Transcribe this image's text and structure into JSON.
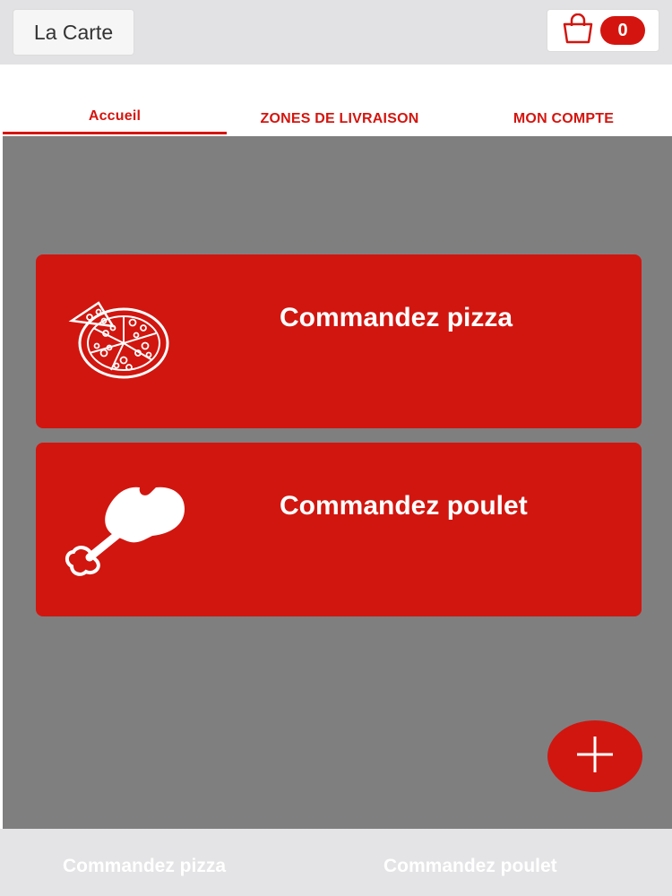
{
  "header": {
    "menu_label": "La Carte",
    "cart_count": "0",
    "cart_icon": "shopping-bag-icon"
  },
  "tabs": [
    {
      "label": "Accueil",
      "active": true
    },
    {
      "label": "ZONES DE LIVRAISON",
      "active": false
    },
    {
      "label": "MON COMPTE",
      "active": false
    }
  ],
  "cards": [
    {
      "label": "Commandez pizza",
      "icon": "pizza-icon"
    },
    {
      "label": "Commandez poulet",
      "icon": "chicken-leg-icon"
    }
  ],
  "fab": {
    "icon": "plus-icon"
  },
  "bottom_nav": [
    {
      "label": "Commandez pizza"
    },
    {
      "label": "Commandez poulet"
    }
  ],
  "colors": {
    "accent": "#d1160f",
    "content_background": "#7f7f80",
    "bar_background": "#e2e2e4"
  }
}
